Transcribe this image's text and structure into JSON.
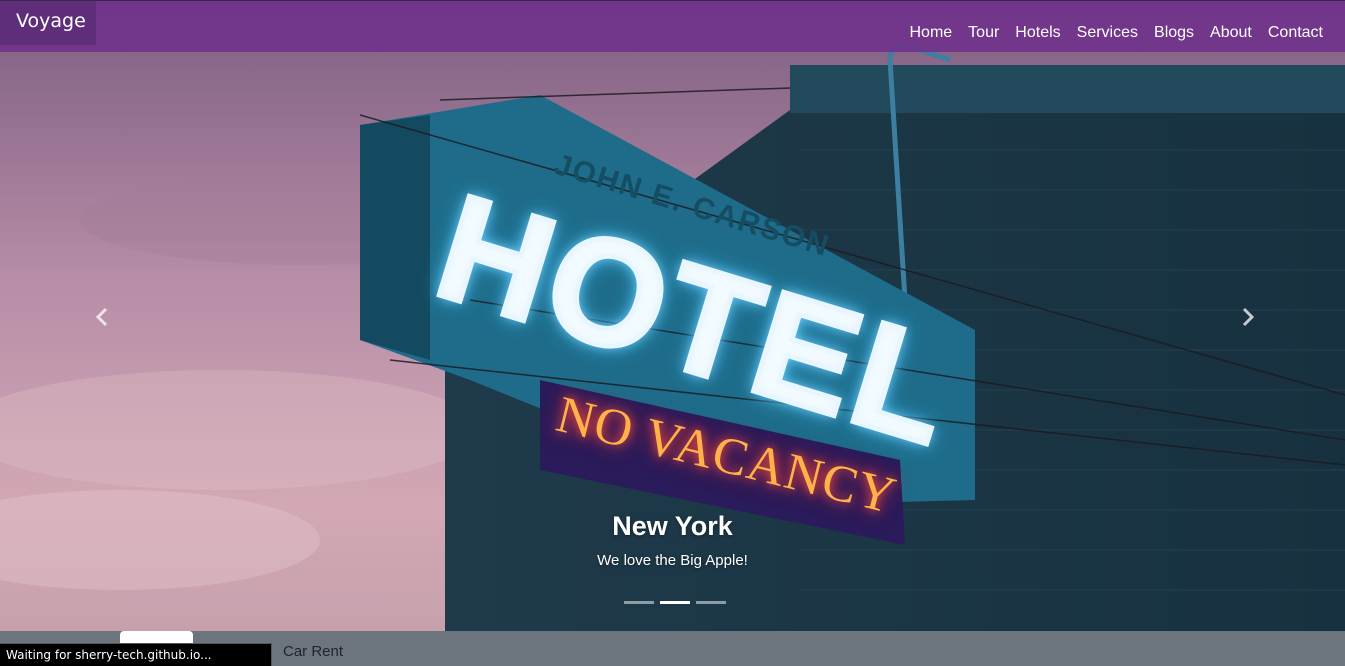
{
  "navbar": {
    "brand": "Voyage",
    "links": [
      "Home",
      "Tour",
      "Hotels",
      "Services",
      "Blogs",
      "About",
      "Contact"
    ]
  },
  "carousel": {
    "prev_icon": "chevron-left-icon",
    "next_icon": "chevron-right-icon",
    "caption_title": "New York",
    "caption_text": "We love the Big Apple!",
    "indicators": 3,
    "active_indicator": 2,
    "sign": {
      "top_text": "JOHN E. CARSON",
      "main_text": "HOTEL",
      "sub_text": "NO VACANCY"
    }
  },
  "bottom": {
    "link": "Car Rent"
  },
  "status_bar": "Waiting for sherry-tech.github.io..."
}
